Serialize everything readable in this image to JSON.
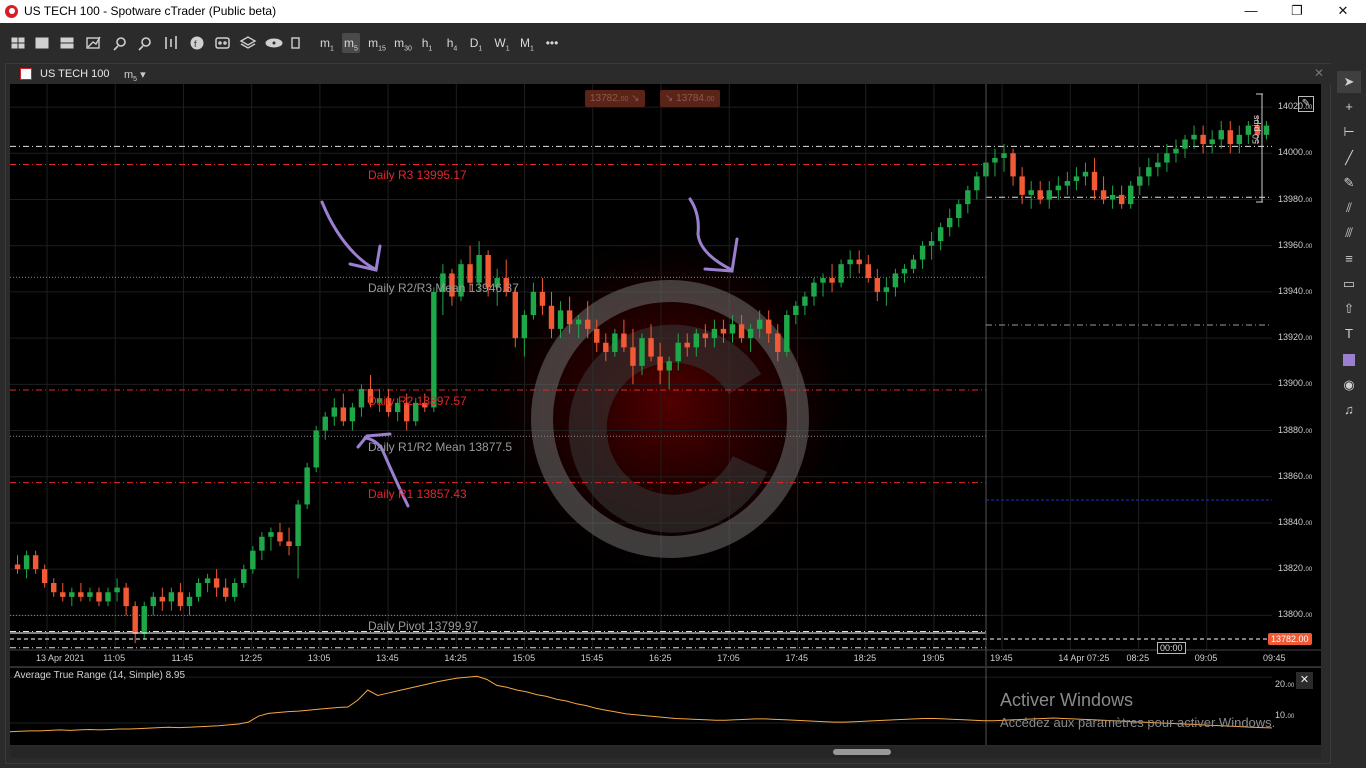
{
  "window": {
    "title": "US TECH 100 - Spotware cTrader (Public beta)",
    "minimize": "—",
    "restore": "❐",
    "close": "✕"
  },
  "toolbar": {
    "icons": [
      "layouts-icon",
      "single-chart-icon",
      "multi-chart-icon",
      "chart-type-icon",
      "zoom-in-icon",
      "zoom-out-icon",
      "bar-chart-icon",
      "f-indicators-icon",
      "cbots-icon",
      "layers-icon",
      "eye-icon",
      "settings-icon"
    ],
    "timeframes": [
      {
        "main": "m",
        "sub": "1"
      },
      {
        "main": "m",
        "sub": "5"
      },
      {
        "main": "m",
        "sub": "15"
      },
      {
        "main": "m",
        "sub": "30"
      },
      {
        "main": "h",
        "sub": "1"
      },
      {
        "main": "h",
        "sub": "4"
      },
      {
        "main": "D",
        "sub": "1"
      },
      {
        "main": "W",
        "sub": "1"
      },
      {
        "main": "M",
        "sub": "1"
      }
    ],
    "more": "•••"
  },
  "chart": {
    "symbol": "US TECH 100",
    "timeframe": "m",
    "timeframe_sub": "5",
    "close": "✕",
    "sell_price": "13782.",
    "sell_price_small": "00",
    "sell_arrow": "↘",
    "buy_price": "13784.",
    "buy_price_small": "00",
    "buy_arrow": "↘",
    "current_price": "13782.00",
    "crosshair_time": "00:00",
    "pips_label": "50 pips",
    "levels": [
      {
        "label": "Daily R3 13995.17",
        "price": 13995.17,
        "color": "#e5262c"
      },
      {
        "label": "Daily R2/R3 Mean 13946.37",
        "price": 13946.37,
        "color": "#888888"
      },
      {
        "label": "Daily R2 13897.57",
        "price": 13897.57,
        "color": "#e5262c"
      },
      {
        "label": "Daily R1/R2 Mean 13877.5",
        "price": 13877.5,
        "color": "#888888"
      },
      {
        "label": "Daily R1 13857.43",
        "price": 13857.43,
        "color": "#e5262c"
      },
      {
        "label": "Daily Pivot 13799.97",
        "price": 13799.97,
        "color": "#888888"
      }
    ],
    "y_ticks": [
      {
        "v": 14020,
        "main": "14020.",
        "sub": "00"
      },
      {
        "v": 14000,
        "main": "14000.",
        "sub": "00"
      },
      {
        "v": 13980,
        "main": "13980.",
        "sub": "00"
      },
      {
        "v": 13960,
        "main": "13960.",
        "sub": "00"
      },
      {
        "v": 13940,
        "main": "13940.",
        "sub": "00"
      },
      {
        "v": 13920,
        "main": "13920.",
        "sub": "00"
      },
      {
        "v": 13900,
        "main": "13900.",
        "sub": "00"
      },
      {
        "v": 13880,
        "main": "13880.",
        "sub": "00"
      },
      {
        "v": 13860,
        "main": "13860.",
        "sub": "00"
      },
      {
        "v": 13840,
        "main": "13840.",
        "sub": "00"
      },
      {
        "v": 13820,
        "main": "13820.",
        "sub": "00"
      },
      {
        "v": 13800,
        "main": "13800.",
        "sub": "00"
      }
    ],
    "x_ticks": [
      "13 Apr 2021",
      "11:05",
      "11:45",
      "12:25",
      "13:05",
      "13:45",
      "14:25",
      "15:05",
      "15:45",
      "16:25",
      "17:05",
      "17:45",
      "18:25",
      "19:05",
      "19:45",
      "14 Apr 07:25",
      "08:25",
      "09:05",
      "09:45"
    ]
  },
  "chart_data": {
    "type": "candlestick",
    "symbol": "US TECH 100",
    "timeframe": "m5",
    "ylim": [
      13785,
      14030
    ],
    "candles": [
      [
        13822,
        13826,
        13818,
        13820
      ],
      [
        13820,
        13828,
        13816,
        13826
      ],
      [
        13826,
        13828,
        13818,
        13820
      ],
      [
        13820,
        13822,
        13812,
        13814
      ],
      [
        13814,
        13816,
        13808,
        13810
      ],
      [
        13810,
        13814,
        13806,
        13808
      ],
      [
        13808,
        13812,
        13804,
        13810
      ],
      [
        13810,
        13814,
        13806,
        13808
      ],
      [
        13808,
        13812,
        13806,
        13810
      ],
      [
        13810,
        13812,
        13804,
        13806
      ],
      [
        13806,
        13812,
        13804,
        13810
      ],
      [
        13810,
        13816,
        13806,
        13812
      ],
      [
        13812,
        13814,
        13800,
        13804
      ],
      [
        13804,
        13806,
        13788,
        13792
      ],
      [
        13792,
        13806,
        13790,
        13804
      ],
      [
        13804,
        13810,
        13800,
        13808
      ],
      [
        13808,
        13812,
        13802,
        13806
      ],
      [
        13806,
        13812,
        13802,
        13810
      ],
      [
        13810,
        13814,
        13802,
        13804
      ],
      [
        13804,
        13810,
        13800,
        13808
      ],
      [
        13808,
        13816,
        13806,
        13814
      ],
      [
        13814,
        13818,
        13810,
        13816
      ],
      [
        13816,
        13820,
        13808,
        13812
      ],
      [
        13812,
        13816,
        13806,
        13808
      ],
      [
        13808,
        13816,
        13806,
        13814
      ],
      [
        13814,
        13822,
        13812,
        13820
      ],
      [
        13820,
        13830,
        13818,
        13828
      ],
      [
        13828,
        13836,
        13824,
        13834
      ],
      [
        13834,
        13838,
        13828,
        13836
      ],
      [
        13836,
        13840,
        13830,
        13832
      ],
      [
        13832,
        13838,
        13826,
        13830
      ],
      [
        13830,
        13850,
        13816,
        13848
      ],
      [
        13848,
        13866,
        13846,
        13864
      ],
      [
        13864,
        13882,
        13862,
        13880
      ],
      [
        13880,
        13888,
        13876,
        13886
      ],
      [
        13886,
        13894,
        13882,
        13890
      ],
      [
        13890,
        13896,
        13882,
        13884
      ],
      [
        13884,
        13892,
        13880,
        13890
      ],
      [
        13890,
        13900,
        13886,
        13898
      ],
      [
        13898,
        13904,
        13890,
        13892
      ],
      [
        13892,
        13898,
        13888,
        13894
      ],
      [
        13894,
        13898,
        13886,
        13888
      ],
      [
        13888,
        13894,
        13884,
        13892
      ],
      [
        13892,
        13896,
        13880,
        13884
      ],
      [
        13884,
        13894,
        13882,
        13892
      ],
      [
        13892,
        13896,
        13888,
        13890
      ],
      [
        13890,
        13942,
        13888,
        13940
      ],
      [
        13940,
        13952,
        13930,
        13948
      ],
      [
        13948,
        13950,
        13934,
        13938
      ],
      [
        13938,
        13954,
        13936,
        13952
      ],
      [
        13952,
        13960,
        13940,
        13944
      ],
      [
        13944,
        13962,
        13940,
        13956
      ],
      [
        13956,
        13958,
        13938,
        13942
      ],
      [
        13942,
        13950,
        13934,
        13946
      ],
      [
        13946,
        13954,
        13938,
        13940
      ],
      [
        13940,
        13942,
        13916,
        13920
      ],
      [
        13920,
        13932,
        13912,
        13930
      ],
      [
        13930,
        13944,
        13928,
        13940
      ],
      [
        13940,
        13946,
        13930,
        13934
      ],
      [
        13934,
        13940,
        13920,
        13924
      ],
      [
        13924,
        13936,
        13920,
        13932
      ],
      [
        13932,
        13938,
        13922,
        13926
      ],
      [
        13926,
        13930,
        13920,
        13928
      ],
      [
        13928,
        13936,
        13920,
        13924
      ],
      [
        13924,
        13928,
        13914,
        13918
      ],
      [
        13918,
        13922,
        13910,
        13914
      ],
      [
        13914,
        13924,
        13912,
        13922
      ],
      [
        13922,
        13928,
        13914,
        13916
      ],
      [
        13916,
        13924,
        13900,
        13908
      ],
      [
        13908,
        13922,
        13904,
        13920
      ],
      [
        13920,
        13926,
        13910,
        13912
      ],
      [
        13912,
        13918,
        13900,
        13906
      ],
      [
        13906,
        13912,
        13898,
        13910
      ],
      [
        13910,
        13922,
        13906,
        13918
      ],
      [
        13918,
        13922,
        13912,
        13916
      ],
      [
        13916,
        13924,
        13912,
        13922
      ],
      [
        13922,
        13926,
        13916,
        13920
      ],
      [
        13920,
        13928,
        13916,
        13924
      ],
      [
        13924,
        13928,
        13918,
        13922
      ],
      [
        13922,
        13930,
        13918,
        13926
      ],
      [
        13926,
        13930,
        13918,
        13920
      ],
      [
        13920,
        13926,
        13914,
        13924
      ],
      [
        13924,
        13932,
        13920,
        13928
      ],
      [
        13928,
        13932,
        13918,
        13922
      ],
      [
        13922,
        13926,
        13910,
        13914
      ],
      [
        13914,
        13932,
        13912,
        13930
      ],
      [
        13930,
        13936,
        13926,
        13934
      ],
      [
        13934,
        13940,
        13930,
        13938
      ],
      [
        13938,
        13946,
        13934,
        13944
      ],
      [
        13944,
        13948,
        13938,
        13946
      ],
      [
        13946,
        13952,
        13940,
        13944
      ],
      [
        13944,
        13954,
        13942,
        13952
      ],
      [
        13952,
        13958,
        13946,
        13954
      ],
      [
        13954,
        13958,
        13948,
        13952
      ],
      [
        13952,
        13956,
        13944,
        13946
      ],
      [
        13946,
        13950,
        13936,
        13940
      ],
      [
        13940,
        13946,
        13934,
        13942
      ],
      [
        13942,
        13950,
        13938,
        13948
      ],
      [
        13948,
        13952,
        13944,
        13950
      ],
      [
        13950,
        13956,
        13948,
        13954
      ],
      [
        13954,
        13962,
        13950,
        13960
      ],
      [
        13960,
        13966,
        13954,
        13962
      ],
      [
        13962,
        13970,
        13958,
        13968
      ],
      [
        13968,
        13976,
        13964,
        13972
      ],
      [
        13972,
        13980,
        13968,
        13978
      ],
      [
        13978,
        13986,
        13974,
        13984
      ],
      [
        13984,
        13992,
        13980,
        13990
      ],
      [
        13990,
        13998,
        13986,
        13996
      ],
      [
        13996,
        14002,
        13990,
        13998
      ],
      [
        13998,
        14004,
        13992,
        14000
      ],
      [
        14000,
        14002,
        13986,
        13990
      ],
      [
        13990,
        13994,
        13978,
        13982
      ],
      [
        13982,
        13988,
        13976,
        13984
      ],
      [
        13984,
        13988,
        13978,
        13980
      ],
      [
        13980,
        13988,
        13976,
        13984
      ],
      [
        13984,
        13990,
        13980,
        13986
      ],
      [
        13986,
        13992,
        13982,
        13988
      ],
      [
        13988,
        13994,
        13984,
        13990
      ],
      [
        13990,
        13996,
        13986,
        13992
      ],
      [
        13992,
        13998,
        13980,
        13984
      ],
      [
        13984,
        13990,
        13978,
        13980
      ],
      [
        13980,
        13986,
        13976,
        13982
      ],
      [
        13982,
        13986,
        13976,
        13978
      ],
      [
        13978,
        13988,
        13976,
        13986
      ],
      [
        13986,
        13994,
        13982,
        13990
      ],
      [
        13990,
        13998,
        13986,
        13994
      ],
      [
        13994,
        14000,
        13990,
        13996
      ],
      [
        13996,
        14004,
        13992,
        14000
      ],
      [
        14000,
        14006,
        13996,
        14002
      ],
      [
        14002,
        14008,
        13998,
        14006
      ],
      [
        14006,
        14012,
        14002,
        14008
      ],
      [
        14008,
        14012,
        14000,
        14004
      ],
      [
        14004,
        14010,
        14000,
        14006
      ],
      [
        14006,
        14014,
        14002,
        14010
      ],
      [
        14010,
        14014,
        14000,
        14004
      ],
      [
        14004,
        14012,
        14000,
        14008
      ],
      [
        14008,
        14014,
        14004,
        14012
      ],
      [
        14012,
        14016,
        14004,
        14008
      ],
      [
        14008,
        14014,
        14006,
        14012
      ]
    ],
    "atr": {
      "label": "Average True Range (14, Simple) 8.95",
      "ylim": [
        5,
        22
      ],
      "y_ticks": [
        {
          "v": 20,
          "main": "20.",
          "sub": "00"
        },
        {
          "v": 10,
          "main": "10.",
          "sub": "00"
        }
      ],
      "values": [
        8.1,
        8.2,
        8.3,
        8.3,
        8.4,
        8.5,
        8.4,
        8.5,
        8.6,
        8.5,
        8.6,
        8.7,
        8.7,
        8.8,
        8.9,
        9.0,
        9.1,
        9.0,
        9.1,
        9.2,
        9.3,
        9.4,
        9.6,
        9.8,
        10.2,
        11.5,
        12.1,
        12.3,
        12.5,
        12.6,
        12.8,
        13.0,
        13.2,
        13.4,
        13.5,
        15.0,
        17.2,
        16.0,
        16.5,
        17.0,
        17.5,
        18.0,
        18.5,
        19.0,
        19.4,
        19.8,
        20.0,
        20.2,
        19.5,
        18.2,
        17.8,
        17.2,
        16.8,
        16.2,
        15.8,
        15.2,
        14.8,
        14.2,
        13.8,
        13.2,
        12.8,
        12.4,
        12.0,
        11.8,
        11.6,
        11.4,
        11.2,
        11.0,
        10.9,
        10.8,
        10.7,
        10.6,
        10.6,
        10.7,
        10.8,
        10.9,
        10.9,
        10.8,
        10.7,
        10.6,
        10.5,
        10.4,
        10.3,
        10.2,
        10.2,
        10.3,
        10.4,
        10.5,
        10.6,
        10.7,
        10.8,
        10.9,
        11.0,
        11.0,
        10.9,
        10.8,
        10.7,
        10.6,
        10.5,
        10.5,
        10.6,
        10.7,
        10.8,
        10.9,
        11.0,
        11.1,
        11.0,
        10.9,
        10.8,
        10.7,
        10.6,
        10.5,
        10.4,
        10.3,
        10.2,
        10.1,
        10.0,
        9.9,
        9.8,
        9.7,
        9.6,
        9.5,
        9.4,
        9.3,
        9.2,
        9.1,
        9.0,
        8.95
      ]
    }
  },
  "annotations": {
    "arrow_color": "#9b7fd0"
  },
  "atr_panel": {
    "label": "Average True Range (14, Simple) 8.95",
    "close": "✕",
    "tick_20": "20.",
    "tick_20_sub": "00",
    "tick_10": "10.",
    "tick_10_sub": "00"
  },
  "watermark": {
    "title": "Activer Windows",
    "subtitle": "Accédez aux paramètres pour activer Windows."
  },
  "sidebar": {
    "icons": [
      "cursor-icon",
      "crosshair-icon",
      "measure-icon",
      "trendline-icon",
      "pencil-icon",
      "fibonacci-icon",
      "parallel-channel-icon",
      "equidistant-icon",
      "rectangle-icon",
      "arrow-up-icon",
      "text-icon",
      "color-swatch-icon",
      "camera-icon",
      "alert-bell-icon"
    ]
  },
  "colors": {
    "bull": "#1ea84a",
    "bear": "#f15a35",
    "pivot_red": "#e5262c",
    "atr_line": "#f5a742"
  }
}
